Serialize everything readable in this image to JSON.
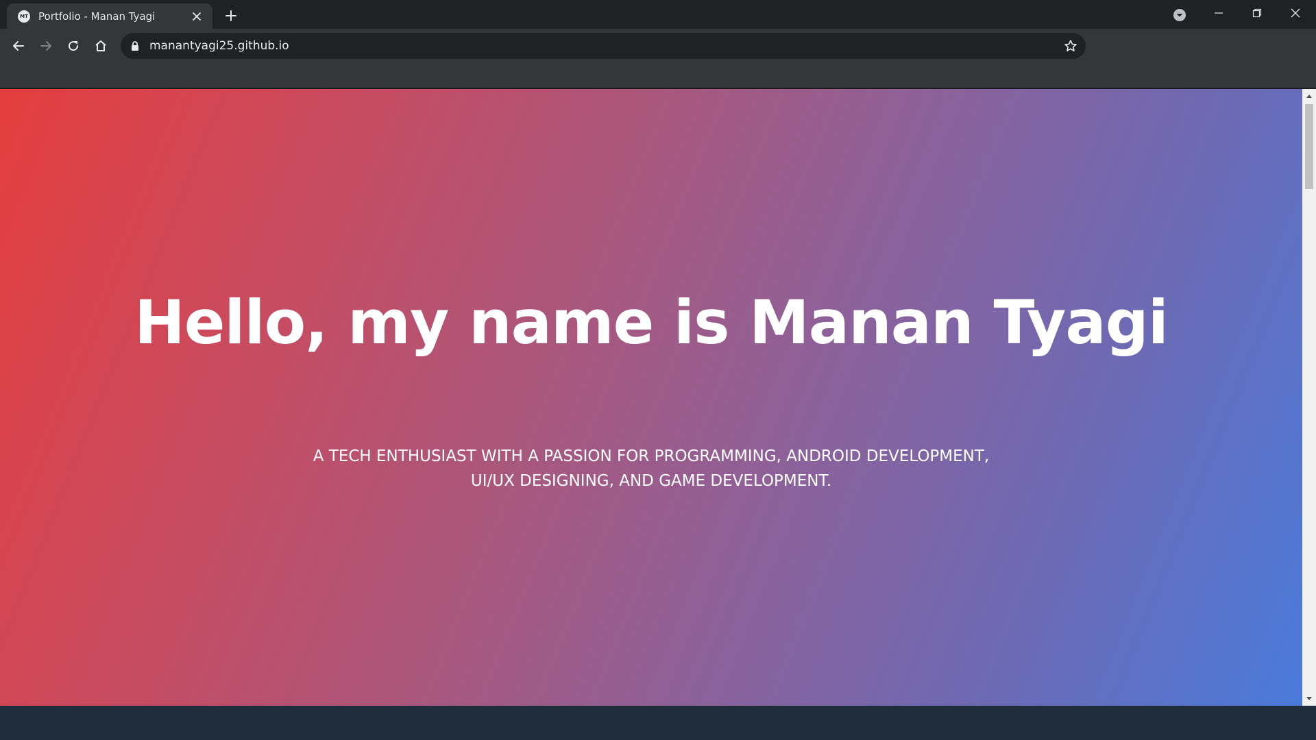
{
  "browser": {
    "tab": {
      "favicon_text": "MT",
      "title": "Portfolio - Manan Tyagi"
    },
    "address_bar": {
      "url": "manantyagi25.github.io"
    },
    "icons": {
      "tab_close": "close-icon",
      "new_tab": "plus-icon",
      "profile": "chevron-down-circle-icon",
      "minimize": "minimize-icon",
      "maximize": "restore-icon",
      "close_window": "close-icon",
      "back": "arrow-left-icon",
      "forward": "arrow-right-icon",
      "reload": "reload-icon",
      "home": "home-icon",
      "lock": "lock-icon",
      "bookmark": "star-icon"
    }
  },
  "page": {
    "hero": {
      "title": "Hello, my name is Manan Tyagi",
      "subtitle": "A TECH ENTHUSIAST WITH A PASSION FOR PROGRAMMING, ANDROID DEVELOPMENT, UI/UX DESIGNING, AND GAME DEVELOPMENT."
    }
  },
  "colors": {
    "tabstrip": "#202124",
    "toolbar": "#35363a",
    "gradient_start": "#e53e3e",
    "gradient_end": "#4a7bdb",
    "footer_band": "#1f2d3b"
  }
}
